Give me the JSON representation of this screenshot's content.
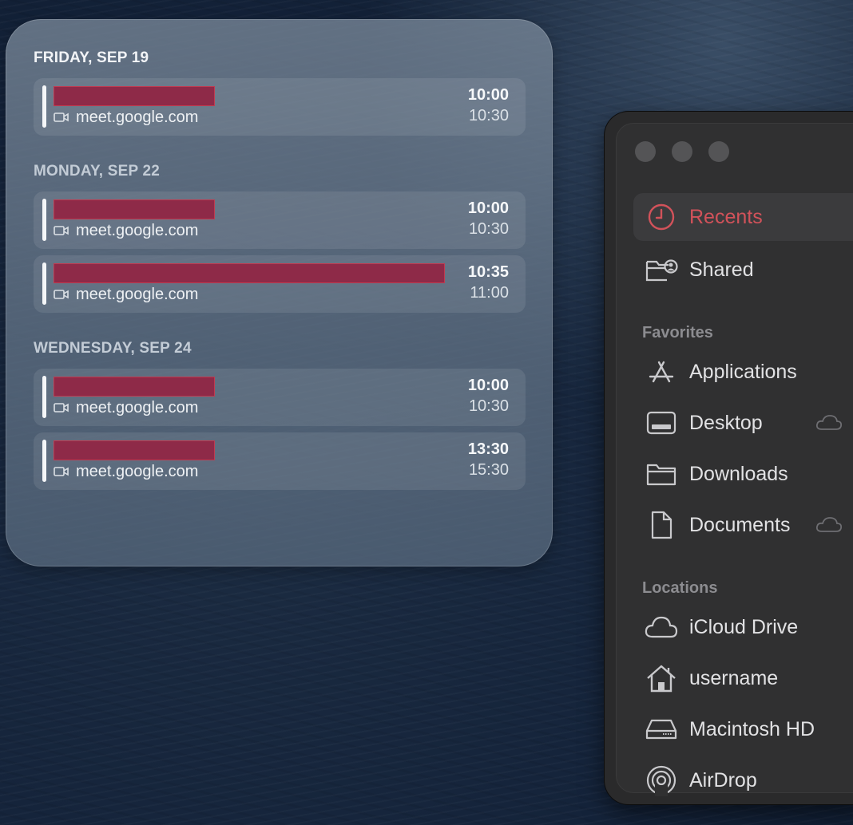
{
  "calendar": {
    "days": [
      {
        "label": "FRIDAY, SEP 19",
        "is_today": true,
        "events": [
          {
            "title": "",
            "location": "meet.google.com",
            "start": "10:00",
            "end": "10:30",
            "title_redacted": true
          }
        ]
      },
      {
        "label": "MONDAY, SEP 22",
        "is_today": false,
        "events": [
          {
            "title": "",
            "location": "meet.google.com",
            "start": "10:00",
            "end": "10:30",
            "title_redacted": true
          },
          {
            "title": "",
            "location": "meet.google.com",
            "start": "10:35",
            "end": "11:00",
            "title_redacted": true
          }
        ]
      },
      {
        "label": "WEDNESDAY, SEP 24",
        "is_today": false,
        "events": [
          {
            "title": "",
            "location": "meet.google.com",
            "start": "10:00",
            "end": "10:30",
            "title_redacted": true
          },
          {
            "title": "",
            "location": "meet.google.com",
            "start": "13:30",
            "end": "15:30",
            "title_redacted": true
          }
        ]
      }
    ],
    "location_icon": "video-camera-icon"
  },
  "finder": {
    "top_items": [
      {
        "label": "Recents",
        "icon": "clock-icon",
        "selected": true
      },
      {
        "label": "Shared",
        "icon": "shared-folder-icon",
        "selected": false
      }
    ],
    "favorites": {
      "heading": "Favorites",
      "items": [
        {
          "label": "Applications",
          "icon": "applications-icon",
          "icloud": false
        },
        {
          "label": "Desktop",
          "icon": "desktop-icon",
          "icloud": true
        },
        {
          "label": "Downloads",
          "icon": "folder-icon",
          "icloud": false
        },
        {
          "label": "Documents",
          "icon": "document-icon",
          "icloud": true
        }
      ]
    },
    "locations": {
      "heading": "Locations",
      "items": [
        {
          "label": "iCloud Drive",
          "icon": "cloud-icon"
        },
        {
          "label": "username",
          "icon": "home-icon"
        },
        {
          "label": "Macintosh HD",
          "icon": "hard-drive-icon"
        },
        {
          "label": "AirDrop",
          "icon": "airdrop-icon"
        }
      ]
    }
  },
  "colors": {
    "accent_red": "#d2525a",
    "redaction": "#8e2a48"
  }
}
